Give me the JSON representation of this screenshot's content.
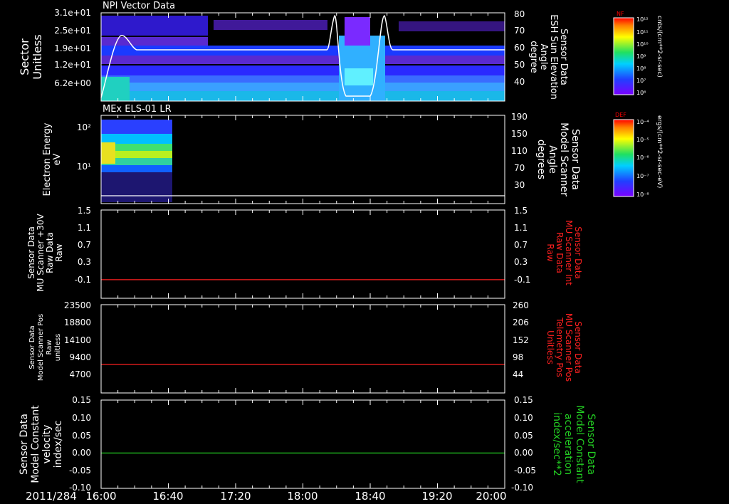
{
  "colors": {
    "background": "#000000",
    "axes": "#ffffff",
    "red_trace": "#ff2020",
    "green_trace": "#22cc22",
    "white_trace": "#ffffff"
  },
  "date_label": "2011/284",
  "x_ticks": [
    "16:00",
    "16:40",
    "17:20",
    "18:00",
    "18:40",
    "19:20",
    "20:00"
  ],
  "colorbar1": {
    "title": "NF",
    "unit": "cnts/(cm**2-sr-sec)",
    "top_label": "10¹²",
    "bottom_label": "10⁶",
    "mid_labels": [
      "10¹¹",
      "10¹⁰",
      "10⁹",
      "10⁸",
      "10⁷"
    ]
  },
  "colorbar2": {
    "title": "DEF",
    "unit": "ergs/(cm**2-sr-sec-eV)",
    "top_label": "10⁻⁴",
    "bottom_label": "10⁻⁸",
    "mid_labels": [
      "10⁻⁵",
      "10⁻⁶",
      "10⁻⁷"
    ]
  },
  "chart_data": [
    {
      "type": "heatmap",
      "title": "NPI Vector Data",
      "ylabel": [
        "Sector",
        "Unitless"
      ],
      "yticks": [
        "3.1e+01",
        "2.5e+01",
        "1.9e+01",
        "1.2e+01",
        "6.2e+00"
      ],
      "y2label": [
        "Sensor Data",
        "ESH Sun Elevation",
        "Angle",
        "degree"
      ],
      "y2ticks": [
        "80",
        "70",
        "60",
        "50",
        "40"
      ],
      "y2lim": [
        30,
        80
      ],
      "overlay_series": {
        "name": "ESH Sun Elevation Angle",
        "x": [
          "16:00",
          "16:05",
          "16:12",
          "16:20",
          "18:40",
          "18:45",
          "18:51",
          "18:56",
          "19:01",
          "19:06",
          "20:00"
        ],
        "y": [
          34,
          72,
          60,
          60,
          60,
          76,
          32,
          32,
          76,
          60,
          60
        ]
      }
    },
    {
      "type": "heatmap",
      "title": "MEx ELS-01 LR",
      "ylabel": [
        "Electron Energy",
        "eV"
      ],
      "yticks": [
        "10²",
        "10¹"
      ],
      "y2label": [
        "Sensor Data",
        "Model Scanner",
        "Angle",
        "degrees"
      ],
      "y2ticks": [
        "190",
        "150",
        "110",
        "70",
        "30"
      ],
      "data_range": [
        "16:00",
        "16:42"
      ]
    },
    {
      "type": "line",
      "ylabel": [
        "Sensor Data",
        "MU Scanner +30V",
        "Raw Data",
        "Raw"
      ],
      "yticks": [
        "1.5",
        "1.1",
        "0.7",
        "0.3",
        "-0.1"
      ],
      "y2ticks": [
        "1.5",
        "1.1",
        "0.7",
        "0.3",
        "-0.1"
      ],
      "y2label": [
        "Sensor Data",
        "MU Scanner Int",
        "Raw Data",
        "Raw"
      ],
      "ylim": [
        -0.4,
        1.5
      ],
      "series": [
        {
          "name": "MU Scanner Int Raw Data",
          "x": [
            "16:00",
            "20:00"
          ],
          "y": [
            0.0,
            0.0
          ]
        }
      ]
    },
    {
      "type": "line",
      "ylabel": [
        "Sensor Data",
        "Model Scanner Pos",
        "Raw",
        "unitless"
      ],
      "yticks": [
        "23500",
        "18800",
        "14100",
        "9400",
        "4700"
      ],
      "y2ticks": [
        "260",
        "206",
        "152",
        "98",
        "44"
      ],
      "y2label": [
        "Sensor Data",
        "MU Scanner Pos",
        "Telemetry Pos",
        "Unitless"
      ],
      "ylim": [
        0,
        23500
      ],
      "series": [
        {
          "name": "MU Scanner Pos Telemetry Pos",
          "x": [
            "16:00",
            "20:00"
          ],
          "y": [
            7600,
            7600
          ]
        }
      ]
    },
    {
      "type": "line",
      "ylabel": [
        "Sensor Data",
        "Model Constant",
        "velocity",
        "index/sec"
      ],
      "yticks": [
        "0.15",
        "0.10",
        "0.05",
        "0.00",
        "-0.05",
        "-0.10"
      ],
      "y2ticks": [
        "0.15",
        "0.10",
        "0.05",
        "0.00",
        "-0.05",
        "-0.10"
      ],
      "y2label": [
        "Sensor Data",
        "Model Constant",
        "acceleration",
        "index/sec**2"
      ],
      "ylim": [
        -0.1,
        0.15
      ],
      "series": [
        {
          "name": "Model Constant acceleration",
          "x": [
            "16:00",
            "20:00"
          ],
          "y": [
            0.0,
            0.0
          ]
        }
      ]
    }
  ]
}
